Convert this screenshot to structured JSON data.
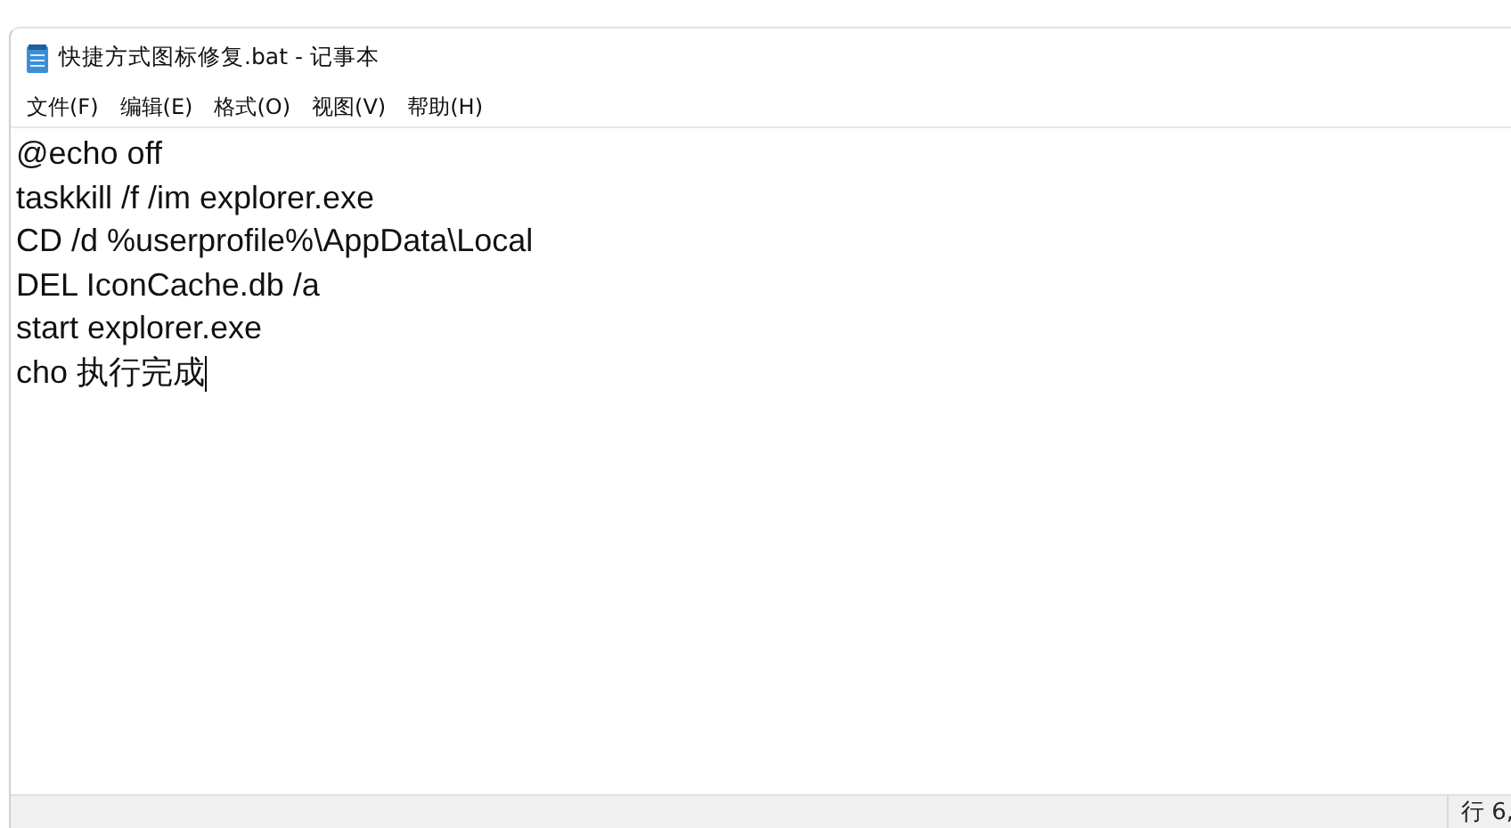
{
  "window": {
    "title": "快捷方式图标修复.bat - 记事本"
  },
  "menu": [
    {
      "label": "文件(F)"
    },
    {
      "label": "编辑(E)"
    },
    {
      "label": "格式(O)"
    },
    {
      "label": "视图(V)"
    },
    {
      "label": "帮助(H)"
    }
  ],
  "editor": {
    "lines": [
      "@echo off",
      "taskkill /f /im explorer.exe",
      "CD /d %userprofile%\\AppData\\Local",
      "DEL IconCache.db /a",
      "start explorer.exe",
      "cho 执行完成"
    ]
  },
  "status_bar": {
    "position": "行 6,"
  }
}
